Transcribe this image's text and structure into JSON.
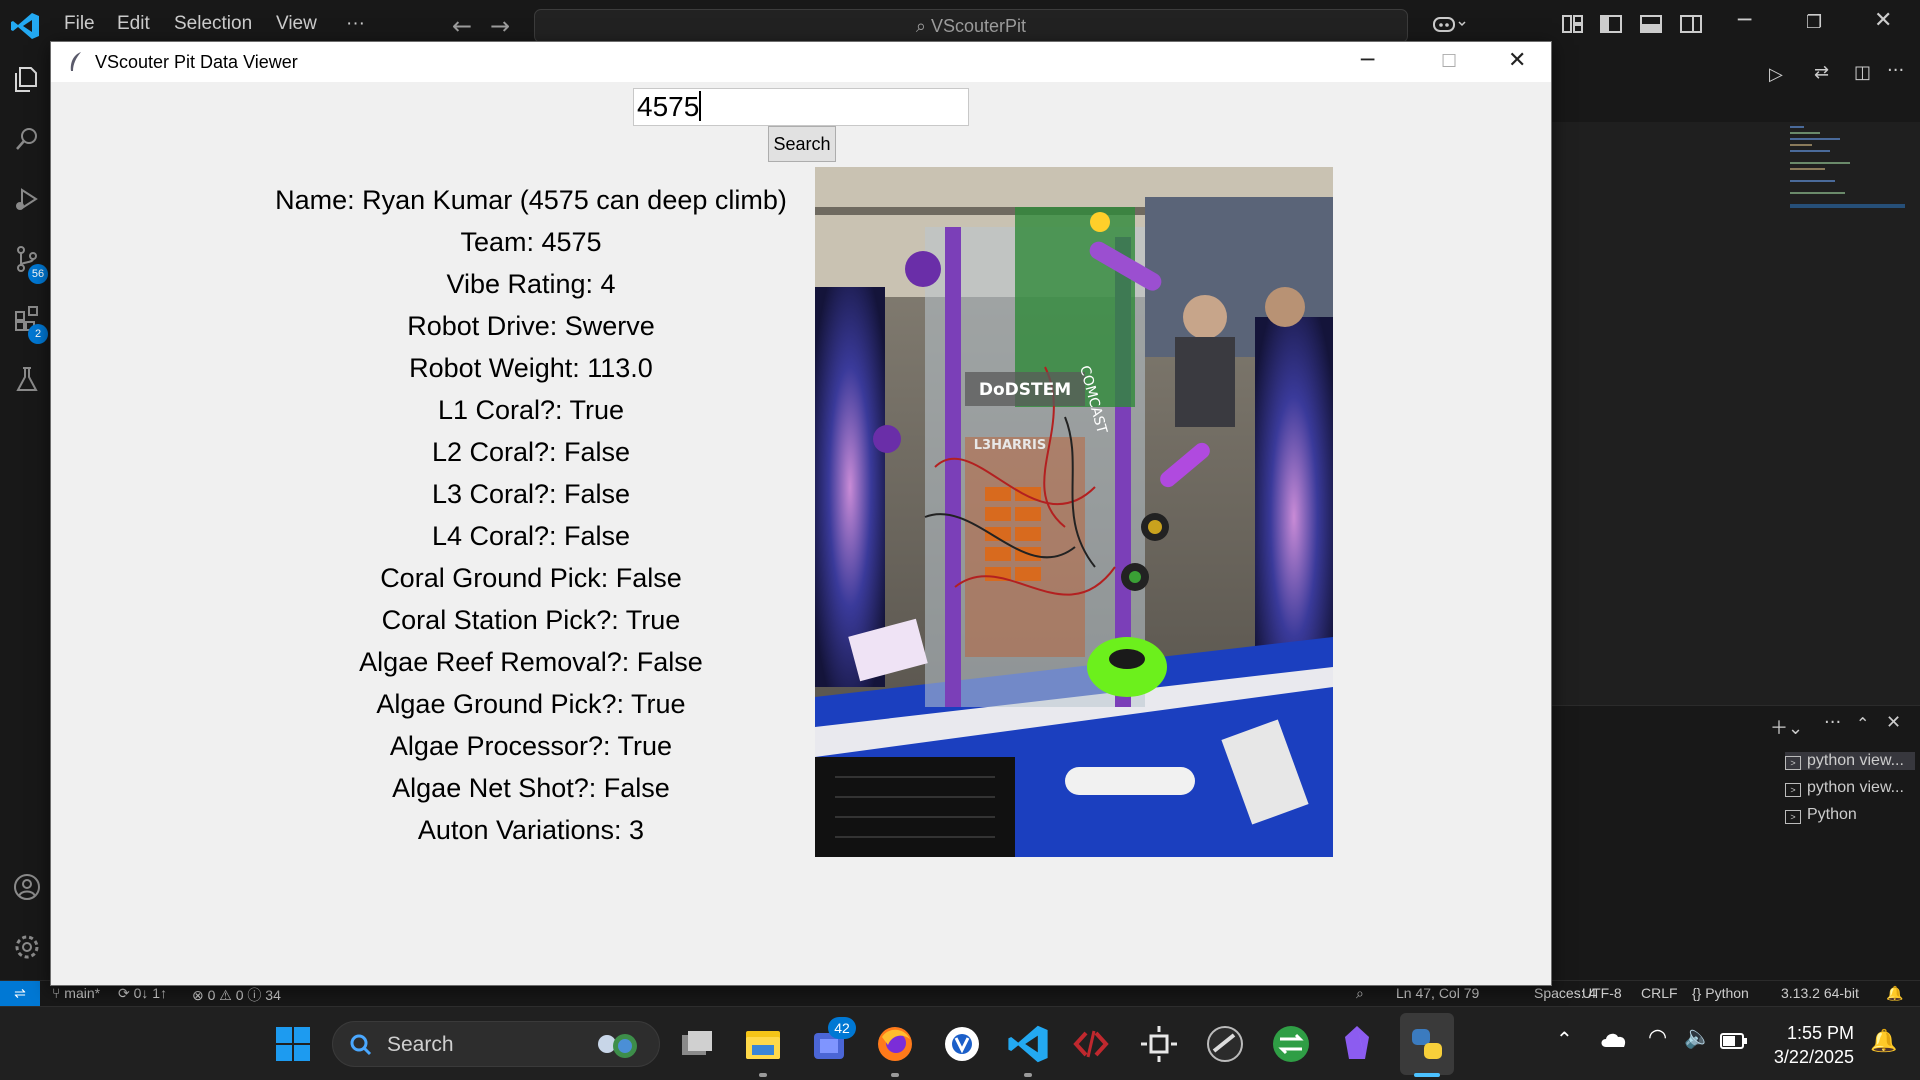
{
  "vscode": {
    "menu": [
      "File",
      "Edit",
      "Selection",
      "View",
      "···"
    ],
    "command_center": "VScouterPit",
    "activity_badges": {
      "source_control": "56",
      "extensions": "2"
    },
    "accent_color": "#0078d4",
    "terminals": [
      "python view...",
      "python view...",
      "Python"
    ],
    "status": {
      "remote": "⇌",
      "branch": "main*",
      "sync": "⟳ 0↓ 1↑",
      "problems": "⊗ 0 ⚠ 0 ⓘ 34",
      "position": "Ln 47, Col 79",
      "spaces": "Spaces: 4",
      "encoding": "UTF-8",
      "eol": "CRLF",
      "language": "{} Python",
      "interpreter": "3.13.2 64-bit"
    }
  },
  "tk_window": {
    "title": "VScouter Pit Data Viewer",
    "search_value": "4575",
    "search_button": "Search",
    "info": [
      "Name: Ryan Kumar (4575 can deep climb)",
      "Team: 4575",
      "Vibe Rating: 4",
      "Robot Drive: Swerve",
      "Robot Weight: 113.0",
      "L1 Coral?: True",
      "L2 Coral?: False",
      "L3 Coral?: False",
      "L4 Coral?: False",
      "Coral Ground Pick: False",
      "Coral Station Pick?: True",
      "Algae Reef Removal?: False",
      "Algae Ground Pick?: True",
      "Algae Processor?: True",
      "Algae Net Shot?: False",
      "Auton Variations: 3"
    ],
    "photo_signage": [
      "DoDSTEM",
      "L3HARRIS",
      "COMCAST"
    ]
  },
  "taskbar": {
    "search_label": "Search",
    "teams_badge": "42",
    "time": "1:55 PM",
    "date": "3/22/2025"
  }
}
